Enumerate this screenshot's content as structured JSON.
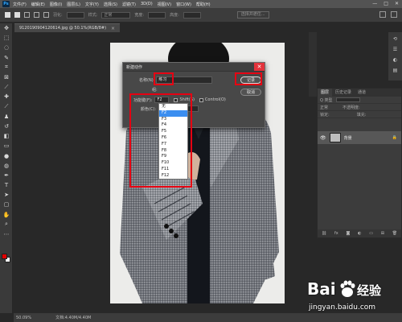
{
  "menubar": {
    "logo": "Ps",
    "items": [
      "文件(F)",
      "编辑(E)",
      "图像(I)",
      "图层(L)",
      "文字(Y)",
      "选择(S)",
      "滤镜(T)",
      "3D(D)",
      "视图(V)",
      "窗口(W)",
      "帮助(H)"
    ],
    "window_controls": [
      "—",
      "□",
      "✕"
    ]
  },
  "options_bar": {
    "feather_label": "羽化:",
    "style_label": "样式:",
    "style_value": "正常",
    "width_label": "宽度:",
    "height_label": "高度:",
    "select_mask_button": "选择并遮住..."
  },
  "document": {
    "tab_title": "9120190904120614.jpg @ 50.1%(RGB/8#)",
    "tab_close": "×"
  },
  "status_bar": {
    "zoom": "50.09%",
    "doc_info": "文档:4.40M/4.40M"
  },
  "dialog": {
    "title": "新建动作",
    "close": "✕",
    "name_label": "名称(N):",
    "name_value": "练习",
    "group_label": "组:",
    "function_key_label": "功能键(F):",
    "function_key_value": "F2",
    "shift_label": "Shift(S)",
    "control_label": "Control(O)",
    "color_label": "颜色(C):",
    "record_button": "记录",
    "cancel_button": "取消"
  },
  "function_key_options": [
    "无",
    "F2",
    "F3",
    "F4",
    "F5",
    "F6",
    "F7",
    "F8",
    "F9",
    "F10",
    "F11",
    "F12"
  ],
  "function_key_selected_index": 1,
  "layers_panel": {
    "tabs": [
      "图层",
      "历史记录",
      "通道"
    ],
    "kind_label": "Q 类型",
    "blend_mode": "正常",
    "opacity_label": "不透明度:",
    "lock_label": "锁定:",
    "fill_label": "填充:",
    "layer_name": "背景",
    "bottom_icons": [
      "link-icon",
      "fx-icon",
      "mask-icon",
      "adjust-icon",
      "folder-icon",
      "new-layer-icon",
      "trash-icon"
    ]
  },
  "watermark": {
    "brand": "Bai",
    "brand_suffix": "经验",
    "url": "jingyan.baidu.com"
  },
  "colors": {
    "annotation_red": "#e60012",
    "foreground_swatch": "#e00000",
    "background_swatch": "#ffffff",
    "dropdown_selection": "#3b8ef0"
  }
}
